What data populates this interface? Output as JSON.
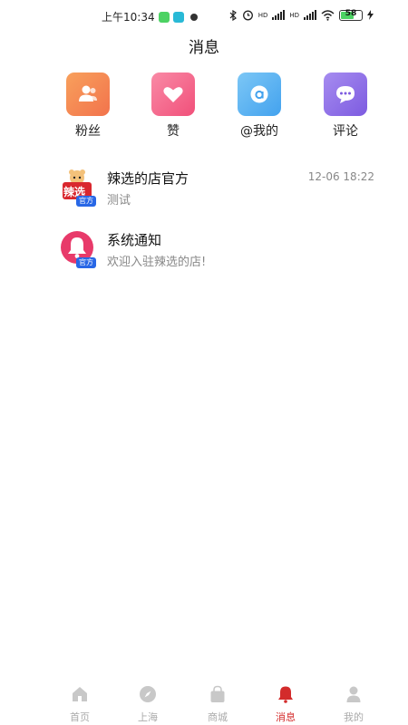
{
  "status_bar": {
    "time": "上午10:34",
    "battery_level": "58",
    "network_label_1": "HD",
    "network_label_2": "HD"
  },
  "header": {
    "title": "消息"
  },
  "shortcuts": [
    {
      "label": "粉丝",
      "icon": "fans-icon",
      "color": "#f58a54"
    },
    {
      "label": "赞",
      "icon": "heart-icon",
      "color": "#f4628a"
    },
    {
      "label": "@我的",
      "icon": "at-icon",
      "color": "#57b2f2"
    },
    {
      "label": "评论",
      "icon": "comment-icon",
      "color": "#8f70e8"
    }
  ],
  "messages": [
    {
      "title": "辣选的店官方",
      "subtitle": "测试",
      "time": "12-06 18:22",
      "avatar_text": "辣选",
      "badge": "官方"
    },
    {
      "title": "系统通知",
      "subtitle": "欢迎入驻辣选的店!",
      "time": "",
      "avatar_icon": "bell-icon",
      "badge": "官方"
    }
  ],
  "tabbar": {
    "items": [
      {
        "label": "首页",
        "icon": "home-icon",
        "active": false
      },
      {
        "label": "上海",
        "icon": "compass-icon",
        "active": false
      },
      {
        "label": "商城",
        "icon": "bag-icon",
        "active": false
      },
      {
        "label": "消息",
        "icon": "bell-icon",
        "active": true
      },
      {
        "label": "我的",
        "icon": "user-icon",
        "active": false
      }
    ],
    "active_color": "#d32b2b",
    "inactive_color": "#aaaaaa"
  }
}
